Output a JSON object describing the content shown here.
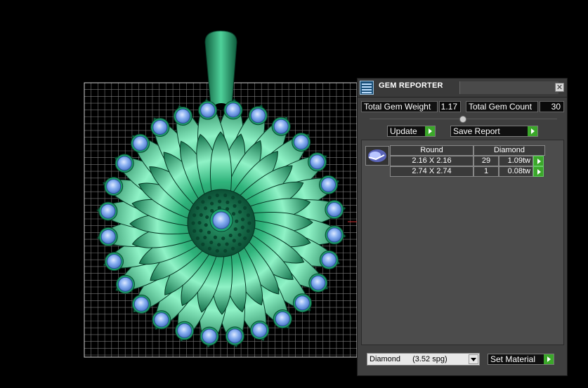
{
  "panel": {
    "title": "GEM REPORTER",
    "close_glyph": "✕",
    "total_weight_label": "Total Gem Weight",
    "total_weight_value": "1.17",
    "total_count_label": "Total Gem Count",
    "total_count_value": "30",
    "update_label": "Update",
    "save_report_label": "Save Report",
    "columns": {
      "shape": "Round",
      "material": "Diamond"
    },
    "rows": [
      {
        "size": "2.16 X 2.16",
        "count": "29",
        "weight": "1.09tw"
      },
      {
        "size": "2.74 X 2.74",
        "count": "1",
        "weight": "0.08tw"
      }
    ],
    "material_select": {
      "name": "Diamond",
      "spg": "(3.52 spg)"
    },
    "set_material_label": "Set Material"
  },
  "colors": {
    "metal": "#1f8a5e",
    "metal_highlight": "#7ff0c0",
    "gem": "#6f9fe8",
    "grid": "#a0a0a0",
    "accent_button": "#3ba72a"
  },
  "viewport": {
    "model": "flower-pendant",
    "petal_count": 28
  }
}
